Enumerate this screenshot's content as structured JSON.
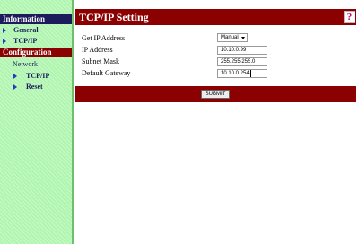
{
  "sidebar": {
    "information_header": "Information",
    "information_items": [
      {
        "label": "General"
      },
      {
        "label": "TCP/IP"
      }
    ],
    "configuration_header": "Configuration",
    "network_label": "Network",
    "network_items": [
      {
        "label": "TCP/IP"
      },
      {
        "label": "Reset"
      }
    ]
  },
  "main": {
    "title": "TCP/IP Setting",
    "help_icon": "?",
    "rows": [
      {
        "label": "Get IP Address",
        "value": "Manual"
      },
      {
        "label": "IP Address",
        "value": "10.10.0.99"
      },
      {
        "label": "Subnet Mask",
        "value": "255.255.255.0"
      },
      {
        "label": "Default Gateway",
        "value": "10.10.0.254"
      }
    ],
    "submit_label": "SUBMIT"
  },
  "colors": {
    "sidebar_bg": "#aef5ae",
    "header_navy": "#1c1c5c",
    "accent_red": "#8b0000",
    "arrow_blue": "#1a40c0"
  }
}
